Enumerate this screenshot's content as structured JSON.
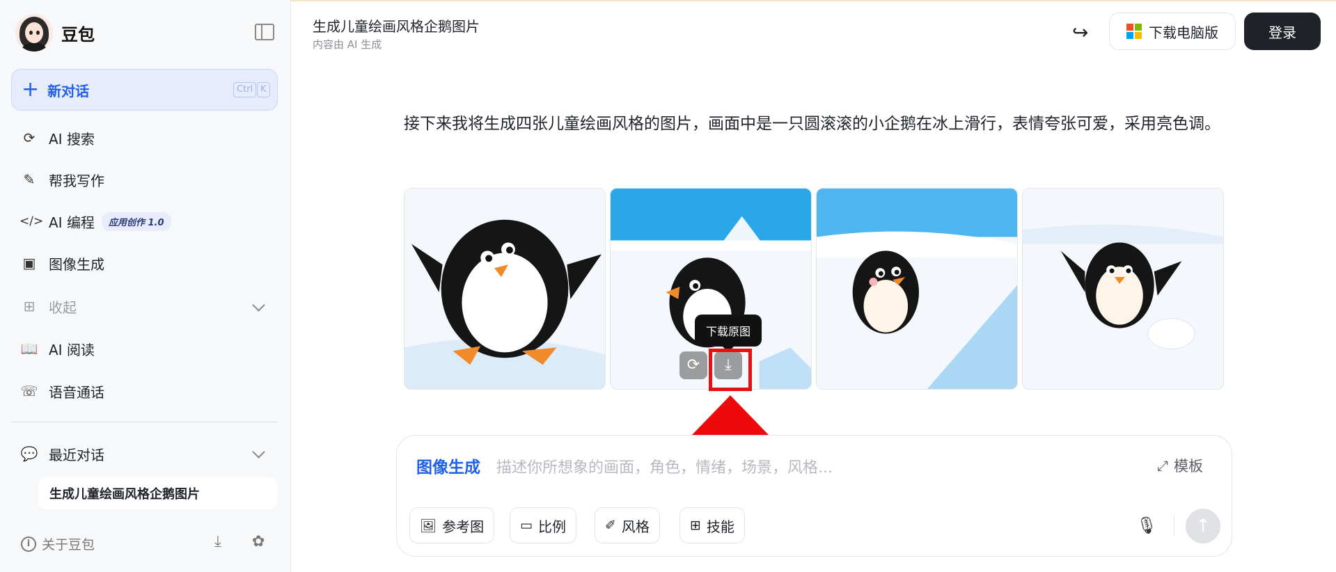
{
  "sidebar": {
    "brand": "豆包",
    "new_chat": {
      "label": "新对话",
      "shortcut_ctrl": "Ctrl",
      "shortcut_key": "K"
    },
    "items": [
      {
        "label": "AI 搜索",
        "icon": "search-sparkle-icon"
      },
      {
        "label": "帮我写作",
        "icon": "pen-sparkle-icon"
      },
      {
        "label": "AI 编程",
        "icon": "code-icon",
        "badge": "应用创作 1.0"
      },
      {
        "label": "图像生成",
        "icon": "image-sparkle-icon"
      },
      {
        "label": "收起",
        "icon": "apps-icon"
      },
      {
        "label": "AI 阅读",
        "icon": "book-icon"
      },
      {
        "label": "语音通话",
        "icon": "phone-icon"
      }
    ],
    "recent": {
      "label": "最近对话",
      "items": [
        "生成儿童绘画风格企鹅图片"
      ]
    },
    "about": "关于豆包"
  },
  "header": {
    "title": "生成儿童绘画风格企鹅图片",
    "subtitle": "内容由 AI 生成",
    "download_label": "下载电脑版",
    "login_label": "登录"
  },
  "message": {
    "text": "接下来我将生成四张儿童绘画风格的图片，画面中是一只圆滚滚的小企鹅在冰上滑行，表情夸张可爱，采用亮色调。",
    "tooltip": "下载原图"
  },
  "composer": {
    "mode": "图像生成",
    "placeholder": "描述你所想象的画面，角色，情绪，场景，风格...",
    "template_label": "模板",
    "chips": [
      "参考图",
      "比例",
      "风格",
      "技能"
    ]
  },
  "colors": {
    "accent": "#2160e8",
    "highlight": "#e81010",
    "dark": "#1f2329"
  }
}
